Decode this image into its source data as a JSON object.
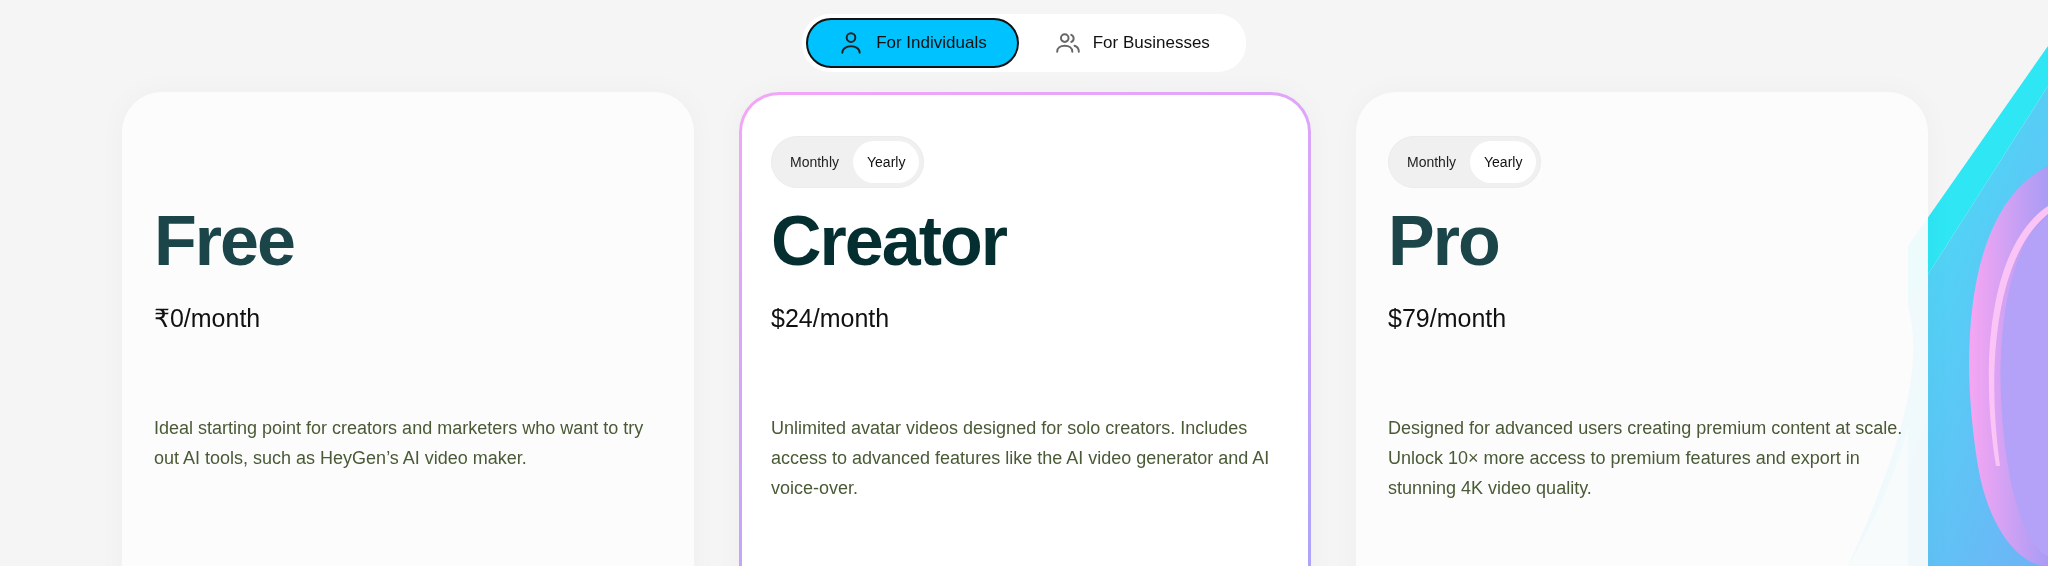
{
  "audience_tabs": [
    {
      "label": "For Individuals",
      "kind": "person",
      "selected": true
    },
    {
      "label": "For Businesses",
      "kind": "group",
      "selected": false
    }
  ],
  "plans": [
    {
      "name": "Free",
      "featured": false,
      "price": "₹0/month",
      "description": "Ideal starting point for creators and marketers who want to try out AI tools, such as HeyGen’s AI video maker."
    },
    {
      "name": "Creator",
      "featured": true,
      "billing": [
        {
          "label": "Monthly",
          "selected": false
        },
        {
          "label": "Yearly",
          "selected": true
        }
      ],
      "price": "$24/month",
      "description": "Unlimited avatar videos designed for solo creators. Includes access to advanced features like the AI video generator and AI voice-over."
    },
    {
      "name": "Pro",
      "featured": false,
      "billing": [
        {
          "label": "Monthly",
          "selected": false
        },
        {
          "label": "Yearly",
          "selected": true
        }
      ],
      "price": "$79/month",
      "description": "Designed for advanced users creating premium content at scale. Unlock 10× more access to premium features and export in stunning 4K video quality."
    }
  ]
}
